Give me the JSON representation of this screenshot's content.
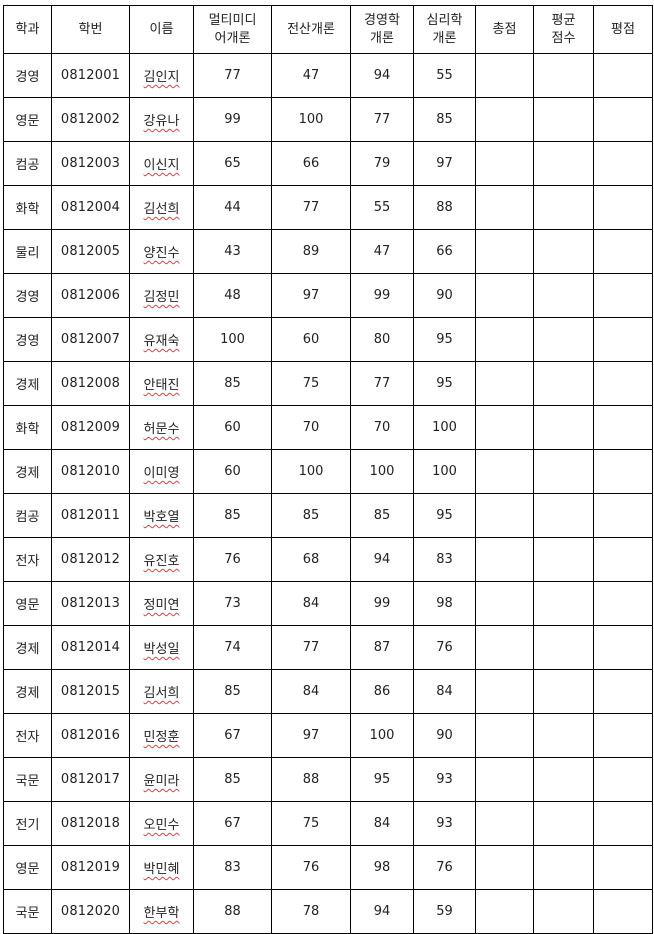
{
  "headers": {
    "dept": "학과",
    "student_id": "학번",
    "name": "이름",
    "multimedia": [
      "멀티미디",
      "어개론"
    ],
    "computing": "전산개론",
    "management": [
      "경영학",
      "개론"
    ],
    "psychology": [
      "심리학",
      "개론"
    ],
    "total": "총점",
    "average": [
      "평균",
      "점수"
    ],
    "grade": "평점"
  },
  "rows": [
    {
      "dept": "경영",
      "id": "0812001",
      "name": "김인지",
      "multimedia": "77",
      "computing": "47",
      "management": "94",
      "psychology": "55"
    },
    {
      "dept": "영문",
      "id": "0812002",
      "name": "강유나",
      "multimedia": "99",
      "computing": "100",
      "management": "77",
      "psychology": "85"
    },
    {
      "dept": "컴공",
      "id": "0812003",
      "name": "이신지",
      "multimedia": "65",
      "computing": "66",
      "management": "79",
      "psychology": "97"
    },
    {
      "dept": "화학",
      "id": "0812004",
      "name": "김선희",
      "multimedia": "44",
      "computing": "77",
      "management": "55",
      "psychology": "88"
    },
    {
      "dept": "물리",
      "id": "0812005",
      "name": "양진수",
      "multimedia": "43",
      "computing": "89",
      "management": "47",
      "psychology": "66"
    },
    {
      "dept": "경영",
      "id": "0812006",
      "name": "김정민",
      "multimedia": "48",
      "computing": "97",
      "management": "99",
      "psychology": "90"
    },
    {
      "dept": "경영",
      "id": "0812007",
      "name": "유재숙",
      "multimedia": "100",
      "computing": "60",
      "management": "80",
      "psychology": "95"
    },
    {
      "dept": "경제",
      "id": "0812008",
      "name": "안태진",
      "multimedia": "85",
      "computing": "75",
      "management": "77",
      "psychology": "95"
    },
    {
      "dept": "화학",
      "id": "0812009",
      "name": "허문수",
      "multimedia": "60",
      "computing": "70",
      "management": "70",
      "psychology": "100"
    },
    {
      "dept": "경제",
      "id": "0812010",
      "name": "이미영",
      "multimedia": "60",
      "computing": "100",
      "management": "100",
      "psychology": "100"
    },
    {
      "dept": "컴공",
      "id": "0812011",
      "name": "박호열",
      "multimedia": "85",
      "computing": "85",
      "management": "85",
      "psychology": "95"
    },
    {
      "dept": "전자",
      "id": "0812012",
      "name": "유진호",
      "multimedia": "76",
      "computing": "68",
      "management": "94",
      "psychology": "83"
    },
    {
      "dept": "영문",
      "id": "0812013",
      "name": "정미연",
      "multimedia": "73",
      "computing": "84",
      "management": "99",
      "psychology": "98"
    },
    {
      "dept": "경제",
      "id": "0812014",
      "name": "박성일",
      "multimedia": "74",
      "computing": "77",
      "management": "87",
      "psychology": "76"
    },
    {
      "dept": "경제",
      "id": "0812015",
      "name": "김서희",
      "multimedia": "85",
      "computing": "84",
      "management": "86",
      "psychology": "84"
    },
    {
      "dept": "전자",
      "id": "0812016",
      "name": "민정훈",
      "multimedia": "67",
      "computing": "97",
      "management": "100",
      "psychology": "90"
    },
    {
      "dept": "국문",
      "id": "0812017",
      "name": "윤미라",
      "multimedia": "85",
      "computing": "88",
      "management": "95",
      "psychology": "93"
    },
    {
      "dept": "전기",
      "id": "0812018",
      "name": "오민수",
      "multimedia": "67",
      "computing": "75",
      "management": "84",
      "psychology": "93"
    },
    {
      "dept": "영문",
      "id": "0812019",
      "name": "박민혜",
      "multimedia": "83",
      "computing": "76",
      "management": "98",
      "psychology": "76"
    },
    {
      "dept": "국문",
      "id": "0812020",
      "name": "한부학",
      "multimedia": "88",
      "computing": "78",
      "management": "94",
      "psychology": "59"
    }
  ],
  "colors": {
    "border": "#000000",
    "text": "#222222",
    "spellcheck_underline": "#c94a4a"
  }
}
